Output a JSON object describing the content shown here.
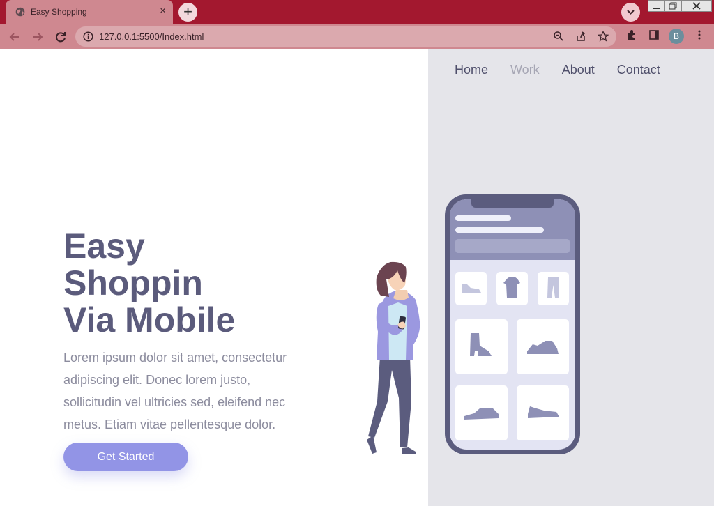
{
  "browser": {
    "tab_title": "Easy Shopping",
    "tab_close": "×",
    "new_tab": "+",
    "url": "127.0.0.1:5500/Index.html",
    "profile_initial": "B",
    "colors": {
      "tabstrip": "#a3182f",
      "toolbar": "#cf8890"
    }
  },
  "nav": {
    "items": [
      {
        "label": "Home"
      },
      {
        "label": "Work"
      },
      {
        "label": "About"
      },
      {
        "label": "Contact"
      }
    ]
  },
  "hero": {
    "title_line1": "Easy",
    "title_line2": "Shoppin",
    "title_line3": "Via Mobile",
    "body": "Lorem ipsum dolor sit amet, consectetur adipiscing elit. Donec lorem justo, sollicitudin vel ultricies sed, eleifend nec metus. Etiam vitae pellentesque dolor.",
    "cta_label": "Get Started"
  },
  "colors": {
    "accent": "#9294e6",
    "heading": "#5b5b7c",
    "panel": "#e5e5ea"
  }
}
